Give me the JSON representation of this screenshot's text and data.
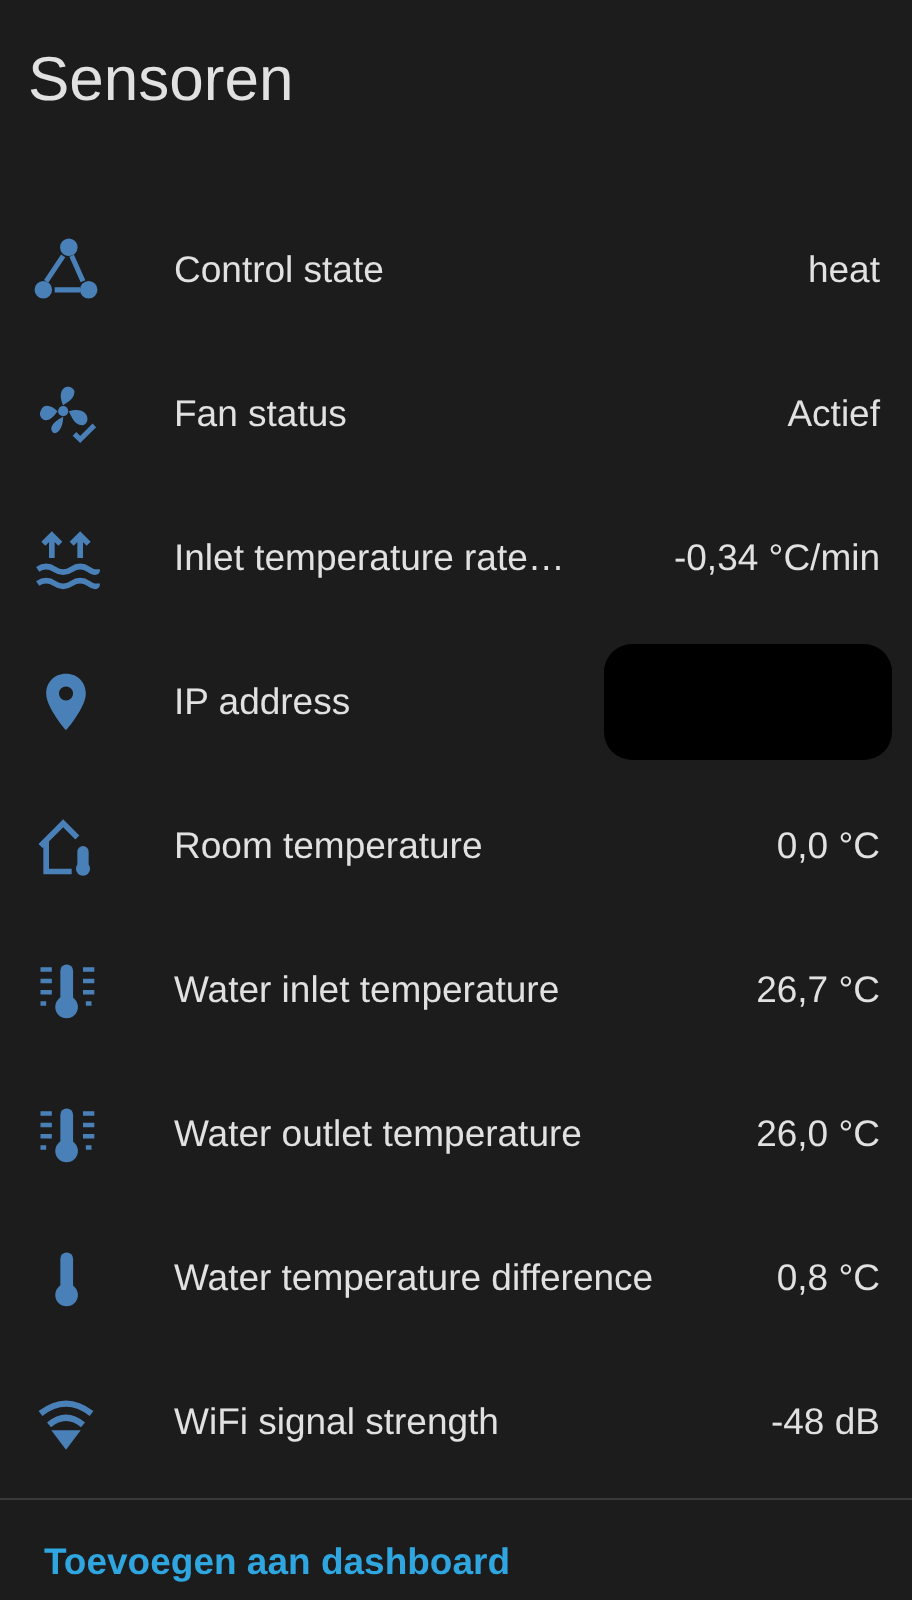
{
  "title": "Sensoren",
  "sensors": [
    {
      "kind": "value",
      "label": "Control state",
      "value": "heat"
    },
    {
      "kind": "value",
      "label": "Fan status",
      "value": "Actief"
    },
    {
      "kind": "value",
      "label": "Inlet temperature rate…",
      "value": "-0,34 °C/min"
    },
    {
      "kind": "redacted",
      "label": "IP address"
    },
    {
      "kind": "value",
      "label": "Room temperature",
      "value": "0,0 °C"
    },
    {
      "kind": "value",
      "label": "Water inlet temperature",
      "value": "26,7 °C"
    },
    {
      "kind": "value",
      "label": "Water outlet temperature",
      "value": "26,0 °C"
    },
    {
      "kind": "value",
      "label": "Water temperature difference",
      "value": "0,8 °C"
    },
    {
      "kind": "value",
      "label": "WiFi signal strength",
      "value": "-48 dB"
    }
  ],
  "footer_link": "Toevoegen aan dashboard"
}
